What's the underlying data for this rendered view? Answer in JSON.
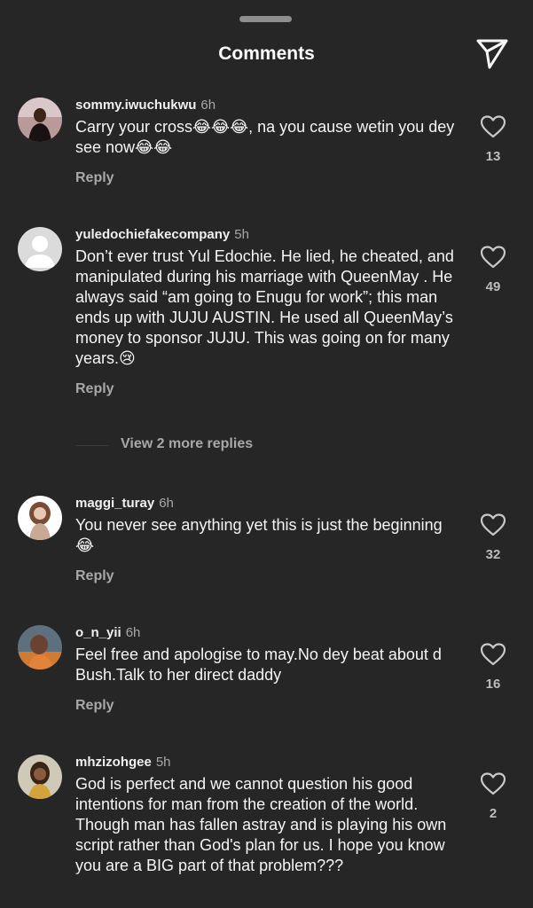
{
  "header": {
    "title": "Comments",
    "share_icon": "send-icon"
  },
  "comments": [
    {
      "username": "sommy.iwuchukwu",
      "time": "6h",
      "text": "Carry your cross😂😂😂, na you cause wetin you dey see now😂😂",
      "reply_label": "Reply",
      "likes": "13"
    },
    {
      "username": "yuledochiefakecompany",
      "time": "5h",
      "text": "Don’t ever trust Yul Edochie. He lied, he cheated, and manipulated during his marriage with QueenMay . He always said “am going to Enugu for work”; this man ends up with JUJU AUSTIN. He used all QueenMay’s money to sponsor JUJU. This was going on for many years.😢",
      "reply_label": "Reply",
      "likes": "49",
      "view_replies": "View 2 more replies"
    },
    {
      "username": "maggi_turay",
      "time": "6h",
      "text": "You never see anything yet this is just the beginning 😂",
      "reply_label": "Reply",
      "likes": "32"
    },
    {
      "username": "o_n_yii",
      "time": "6h",
      "text": "Feel free and apologise to may.No dey beat about d Bush.Talk to her direct daddy",
      "reply_label": "Reply",
      "likes": "16"
    },
    {
      "username": "mhzizohgee",
      "time": "5h",
      "text": "God is perfect and we cannot question his good intentions for man from the creation of the world. Though man has fallen astray and is playing his own script rather than God's plan for us. I hope you know you are a BIG part of that problem???",
      "likes": "2"
    }
  ],
  "colors": {
    "background": "#262626",
    "secondary_text": "#a8a8a8",
    "primary_text": "#f5f5f5"
  }
}
